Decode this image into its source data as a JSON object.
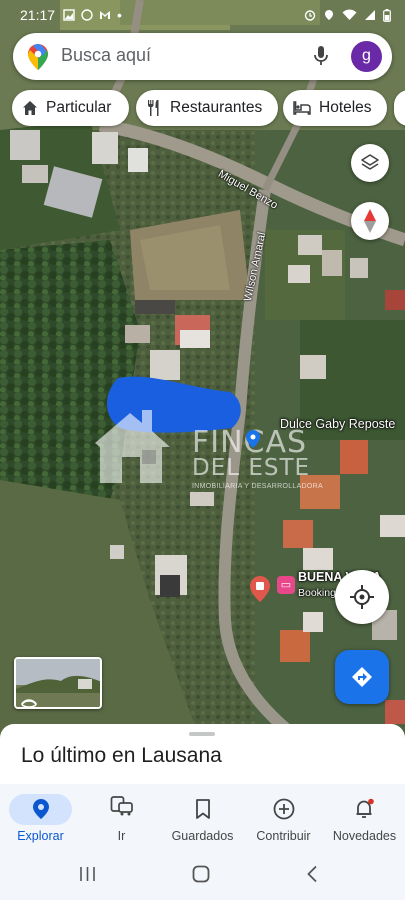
{
  "status_bar": {
    "time": "21:17"
  },
  "search": {
    "placeholder": "Busca aquí",
    "avatar_initial": "g"
  },
  "chips": [
    {
      "label": "Particular",
      "icon": "home-icon"
    },
    {
      "label": "Restaurantes",
      "icon": "restaurant-icon"
    },
    {
      "label": "Hoteles",
      "icon": "hotel-icon"
    }
  ],
  "map": {
    "streets": [
      "Miguel Benzo",
      "Wilson Amaral"
    ],
    "places": [
      {
        "name": "Dulce Gaby Reposte"
      },
      {
        "name": "BUENA VISTA",
        "subtitle": "Booking.com Hotel"
      }
    ],
    "watermark": {
      "line1": "FINCAS",
      "line2": "DEL ESTE",
      "line3": "INMOBILIARIA Y DESARROLLADORA"
    },
    "marked_area_color": "#1a5fe0"
  },
  "sheet": {
    "title": "Lo último en Lausana"
  },
  "nav": {
    "items": [
      {
        "label": "Explorar",
        "icon": "pin-icon",
        "active": true
      },
      {
        "label": "Ir",
        "icon": "commute-icon"
      },
      {
        "label": "Guardados",
        "icon": "bookmark-icon"
      },
      {
        "label": "Contribuir",
        "icon": "add-circle-icon"
      },
      {
        "label": "Novedades",
        "icon": "bell-icon"
      }
    ]
  },
  "colors": {
    "accent": "#1a73e8",
    "active_nav": "#0b57d0",
    "avatar": "#6a2aa8"
  }
}
